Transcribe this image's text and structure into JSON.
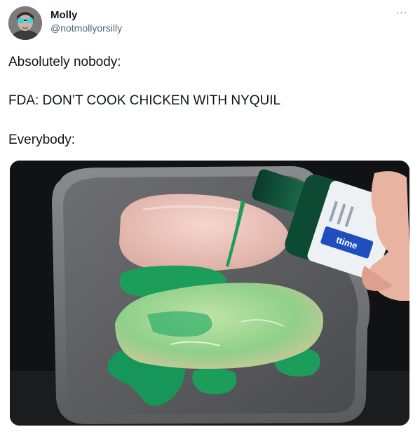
{
  "tweet": {
    "author": {
      "display_name": "Molly",
      "handle": "@notmollyorsilly"
    },
    "more_label": "···",
    "lines": [
      "Absolutely nobody:",
      "FDA: DON’T COOK CHICKEN WITH NYQUIL",
      "Everybody:"
    ],
    "media": {
      "bottle_label": "ttime"
    }
  },
  "colors": {
    "text": "#0f1419",
    "muted": "#536471",
    "nyquil_green": "#1c9e5a",
    "pan_gray": "#5d5e61"
  }
}
